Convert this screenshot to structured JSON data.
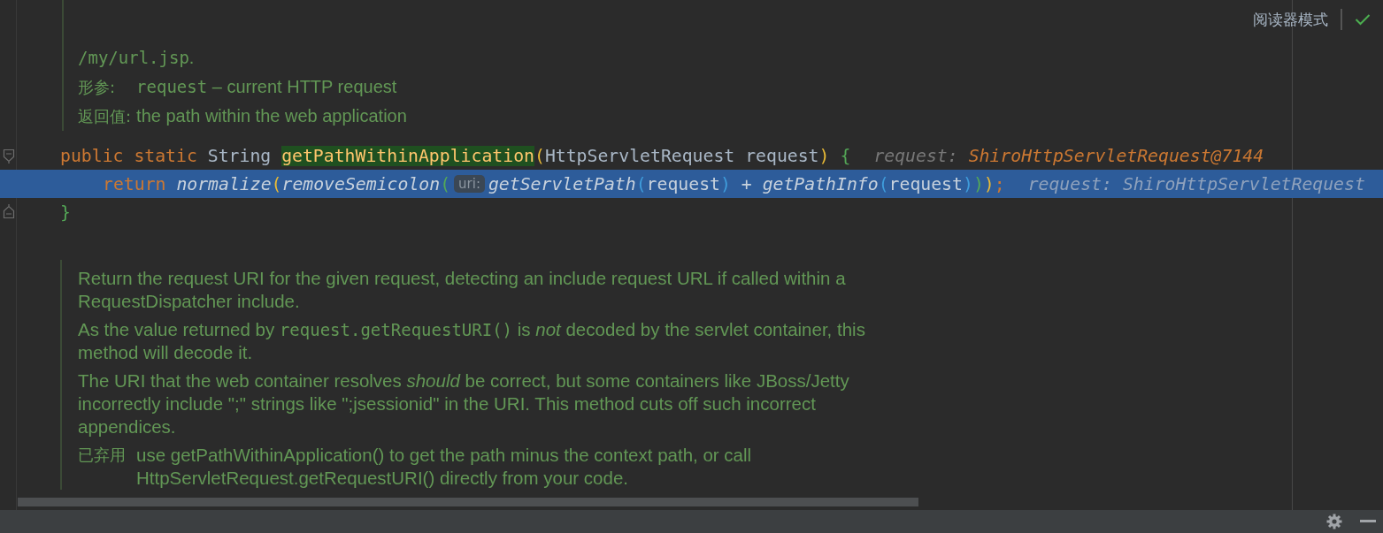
{
  "toolbar": {
    "reader_mode": "阅读器模式"
  },
  "header_doc": {
    "lines": [
      [
        {
          "kind": "code",
          "text": "/my/url.jsp"
        },
        {
          "kind": "text",
          "text": "."
        }
      ]
    ],
    "tags": [
      {
        "label": "形参:",
        "segments": [
          {
            "kind": "code",
            "text": "request"
          },
          {
            "kind": "text",
            "text": " – current HTTP request"
          }
        ]
      },
      {
        "label": "返回值:",
        "segments": [
          {
            "kind": "text",
            "text": "the path within the web application"
          }
        ]
      }
    ]
  },
  "code_lines": [
    {
      "selected": false,
      "kind": "block-start",
      "tokens": [
        {
          "kind": "keyword",
          "text": "public "
        },
        {
          "kind": "keyword",
          "text": "static "
        },
        {
          "kind": "plain",
          "text": "String "
        },
        {
          "kind": "decl",
          "text": "getPathWithinApplication"
        },
        {
          "kind": "paren-1",
          "text": "("
        },
        {
          "kind": "plain",
          "text": "HttpServletRequest request"
        },
        {
          "kind": "paren-1",
          "text": ")"
        },
        {
          "kind": "paren-2",
          "text": "{"
        }
      ],
      "debug": {
        "label": "request:",
        "value": "ShiroHttpServletRequest@7144"
      },
      "children": [
        {
          "selected": true,
          "tokens": [
            {
              "kind": "keyword",
              "text": "return "
            },
            {
              "kind": "call",
              "text": "normalize"
            },
            {
              "kind": "paren-1",
              "text": "("
            },
            {
              "kind": "call",
              "text": "removeSemicolon"
            },
            {
              "kind": "paren-2",
              "text": "("
            },
            {
              "kind": "inlay",
              "text": "uri:"
            },
            {
              "kind": "call",
              "text": "getServletPath"
            },
            {
              "kind": "paren-3",
              "text": "("
            },
            {
              "kind": "plain",
              "text": "request"
            },
            {
              "kind": "paren-3",
              "text": ")"
            },
            {
              "kind": "plain",
              "text": " + "
            },
            {
              "kind": "call",
              "text": "getPathInfo"
            },
            {
              "kind": "paren-3",
              "text": "("
            },
            {
              "kind": "plain",
              "text": "request"
            },
            {
              "kind": "paren-3",
              "text": ")"
            },
            {
              "kind": "paren-2",
              "text": ")"
            },
            {
              "kind": "paren-1",
              "text": ")"
            },
            {
              "kind": "keyword",
              "text": ";"
            }
          ],
          "debug": {
            "label": "request:",
            "value": "ShiroHttpServletRequest"
          }
        }
      ]
    },
    {
      "selected": false,
      "kind": "block-end",
      "tokens": [
        {
          "kind": "paren-2",
          "text": "}"
        }
      ]
    }
  ],
  "doc": {
    "paragraphs": [
      [
        {
          "kind": "text",
          "text": "Return the request URI for the given request, detecting an include request URL if called within a RequestDispatcher include."
        }
      ],
      [
        {
          "kind": "text",
          "text": "As the value returned by "
        },
        {
          "kind": "code",
          "text": "request.getRequestURI()"
        },
        {
          "kind": "text",
          "text": " is "
        },
        {
          "kind": "em",
          "text": "not"
        },
        {
          "kind": "text",
          "text": " decoded by the servlet container, this method will decode it."
        }
      ],
      [
        {
          "kind": "text",
          "text": "The URI that the web container resolves "
        },
        {
          "kind": "em",
          "text": "should"
        },
        {
          "kind": "text",
          "text": " be correct, but some containers like JBoss/Jetty incorrectly include \";\" strings like \";jsessionid\" in the URI. This method cuts off such incorrect appendices."
        }
      ]
    ],
    "tags": [
      {
        "label": "已弃用",
        "segments": [
          {
            "kind": "text",
            "text": "use getPathWithinApplication() to get the path minus the context path, or call HttpServletRequest.getRequestURI() directly from your code."
          }
        ]
      }
    ]
  }
}
